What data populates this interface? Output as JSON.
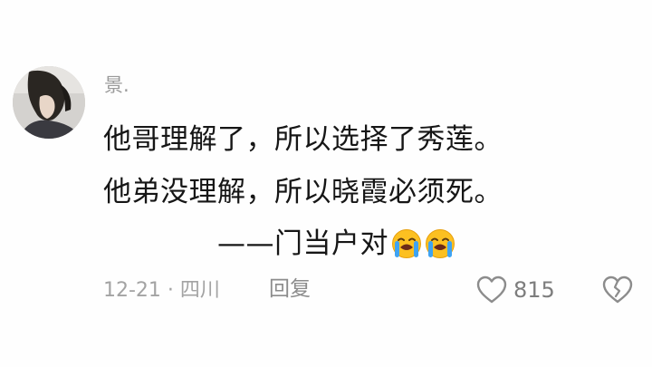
{
  "comment": {
    "username": "景.",
    "lines": [
      "他哥理解了，所以选择了秀莲。",
      "他弟没理解，所以晓霞必须死。",
      "——门当户对"
    ],
    "emojis": [
      "loudly-crying-face-icon",
      "loudly-crying-face-icon"
    ],
    "date_location": "12-21 · 四川",
    "reply_label": "回复",
    "like_count": "815"
  },
  "colors": {
    "background": "#fefefe",
    "text": "#161616",
    "meta": "#a3a3a3",
    "icon": "#8c8c8c"
  }
}
